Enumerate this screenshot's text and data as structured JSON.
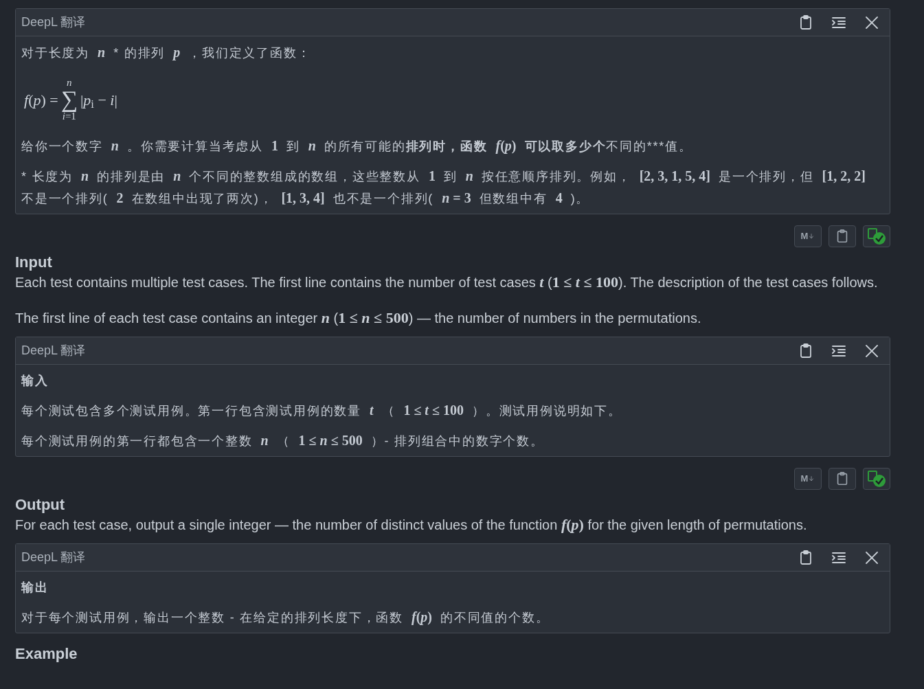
{
  "sections": [
    {
      "kind": "translation",
      "header": "DeepL 翻译",
      "paragraphs": [
        {
          "kind": "text",
          "segments": [
            {
              "kind": "text",
              "text": "对于长度为"
            },
            {
              "kind": "math",
              "text": "*n*"
            },
            {
              "kind": "text",
              "text": "* 的排列"
            },
            {
              "kind": "math",
              "text": "*p*"
            },
            {
              "kind": "text",
              "text": "，我们定义了函数："
            }
          ]
        },
        {
          "kind": "formula",
          "lhs": "*f*(*p*) =",
          "upper": "*n*",
          "sigma": "∑",
          "lower": "*i*=1",
          "body": "|*p*$_{i}$ − *i*|"
        },
        {
          "kind": "text",
          "segments": [
            {
              "kind": "text",
              "text": "给你一个数字"
            },
            {
              "kind": "math",
              "text": "*n*"
            },
            {
              "kind": "text",
              "text": "。你需要计算当考虑从"
            },
            {
              "kind": "math",
              "text": "1"
            },
            {
              "kind": "text",
              "text": "到"
            },
            {
              "kind": "math",
              "text": "*n*"
            },
            {
              "kind": "text",
              "text": "的所有可能的"
            },
            {
              "kind": "bold",
              "text": "排列时，函数"
            },
            {
              "kind": "math",
              "text": "*f*(*p*)"
            },
            {
              "kind": "bold",
              "text": "可以取多少个"
            },
            {
              "kind": "text",
              "text": "不同的***值。"
            }
          ]
        },
        {
          "kind": "text",
          "segments": [
            {
              "kind": "text",
              "text": "* 长度为"
            },
            {
              "kind": "math",
              "text": "*n*"
            },
            {
              "kind": "text",
              "text": "的排列是由"
            },
            {
              "kind": "math",
              "text": "*n*"
            },
            {
              "kind": "text",
              "text": "个不同的整数组成的数组，这些整数从"
            },
            {
              "kind": "math",
              "text": "1"
            },
            {
              "kind": "text",
              "text": "到"
            },
            {
              "kind": "math",
              "text": "*n*"
            },
            {
              "kind": "text",
              "text": "按任意顺序排列。例如，"
            },
            {
              "kind": "math",
              "text": "[2, 3, 1, 5, 4]"
            },
            {
              "kind": "text",
              "text": "是一个排列，但"
            },
            {
              "kind": "math",
              "text": "[1, 2, 2]"
            },
            {
              "kind": "text",
              "text": "不是一个排列("
            },
            {
              "kind": "math",
              "text": "2"
            },
            {
              "kind": "text",
              "text": "在数组中出现了两次)，"
            },
            {
              "kind": "math",
              "text": "[1, 3, 4]"
            },
            {
              "kind": "text",
              "text": "也不是一个排列("
            },
            {
              "kind": "math",
              "text": "*n* = 3"
            },
            {
              "kind": "text",
              "text": "但数组中有"
            },
            {
              "kind": "math",
              "text": "4"
            },
            {
              "kind": "text",
              "text": ")。"
            }
          ]
        }
      ]
    },
    {
      "kind": "toolbar",
      "buttons": [
        {
          "kind": "markdown",
          "label": "M"
        },
        {
          "kind": "copy"
        },
        {
          "kind": "translate_done"
        }
      ]
    },
    {
      "kind": "statement",
      "title": "Input",
      "paragraphs": [
        {
          "kind": "text",
          "segments": [
            {
              "kind": "text",
              "text": "Each test contains multiple test cases. The first line contains the number of test cases "
            },
            {
              "kind": "math",
              "text": "*t*"
            },
            {
              "kind": "text",
              "text": " ("
            },
            {
              "kind": "math",
              "text": "1 ≤ *t* ≤ 100"
            },
            {
              "kind": "text",
              "text": "). The description of the test cases follows."
            }
          ]
        },
        {
          "kind": "text",
          "segments": [
            {
              "kind": "text",
              "text": "The first line of each test case contains an integer "
            },
            {
              "kind": "math",
              "text": "*n*"
            },
            {
              "kind": "text",
              "text": " ("
            },
            {
              "kind": "math",
              "text": "1 ≤ *n* ≤ 500"
            },
            {
              "kind": "text",
              "text": ") — the number of numbers in the permutations."
            }
          ]
        }
      ]
    },
    {
      "kind": "translation",
      "header": "DeepL 翻译",
      "paragraphs": [
        {
          "kind": "text",
          "segments": [
            {
              "kind": "bold",
              "text": "输入"
            }
          ]
        },
        {
          "kind": "text",
          "segments": [
            {
              "kind": "text",
              "text": "每个测试包含多个测试用例。第一行包含测试用例的数量"
            },
            {
              "kind": "math",
              "text": "*t*"
            },
            {
              "kind": "text",
              "text": "（"
            },
            {
              "kind": "math",
              "text": "1 ≤ *t* ≤ 100"
            },
            {
              "kind": "text",
              "text": "）。测试用例说明如下。"
            }
          ]
        },
        {
          "kind": "text",
          "segments": [
            {
              "kind": "text",
              "text": "每个测试用例的第一行都包含一个整数"
            },
            {
              "kind": "math",
              "text": "*n*"
            },
            {
              "kind": "text",
              "text": "（"
            },
            {
              "kind": "math",
              "text": "1 ≤ *n* ≤ 500"
            },
            {
              "kind": "text",
              "text": "）- 排列组合中的数字个数。"
            }
          ]
        }
      ]
    },
    {
      "kind": "toolbar",
      "buttons": [
        {
          "kind": "markdown",
          "label": "M"
        },
        {
          "kind": "copy"
        },
        {
          "kind": "translate_done"
        }
      ]
    },
    {
      "kind": "statement",
      "title": "Output",
      "paragraphs": [
        {
          "kind": "text",
          "segments": [
            {
              "kind": "text",
              "text": "For each test case, output a single integer — the number of distinct values of the function "
            },
            {
              "kind": "math",
              "text": "*f*(*p*)"
            },
            {
              "kind": "text",
              "text": " for the given length of permutations."
            }
          ]
        }
      ]
    },
    {
      "kind": "translation",
      "header": "DeepL 翻译",
      "paragraphs": [
        {
          "kind": "text",
          "segments": [
            {
              "kind": "bold",
              "text": "输出"
            }
          ]
        },
        {
          "kind": "text",
          "segments": [
            {
              "kind": "text",
              "text": "对于每个测试用例，输出一个整数 - 在给定的排列长度下，函数"
            },
            {
              "kind": "math",
              "text": "*f*(*p*)"
            },
            {
              "kind": "text",
              "text": "的不同值的个数。"
            }
          ]
        }
      ]
    },
    {
      "kind": "statement",
      "title": "Example"
    }
  ]
}
